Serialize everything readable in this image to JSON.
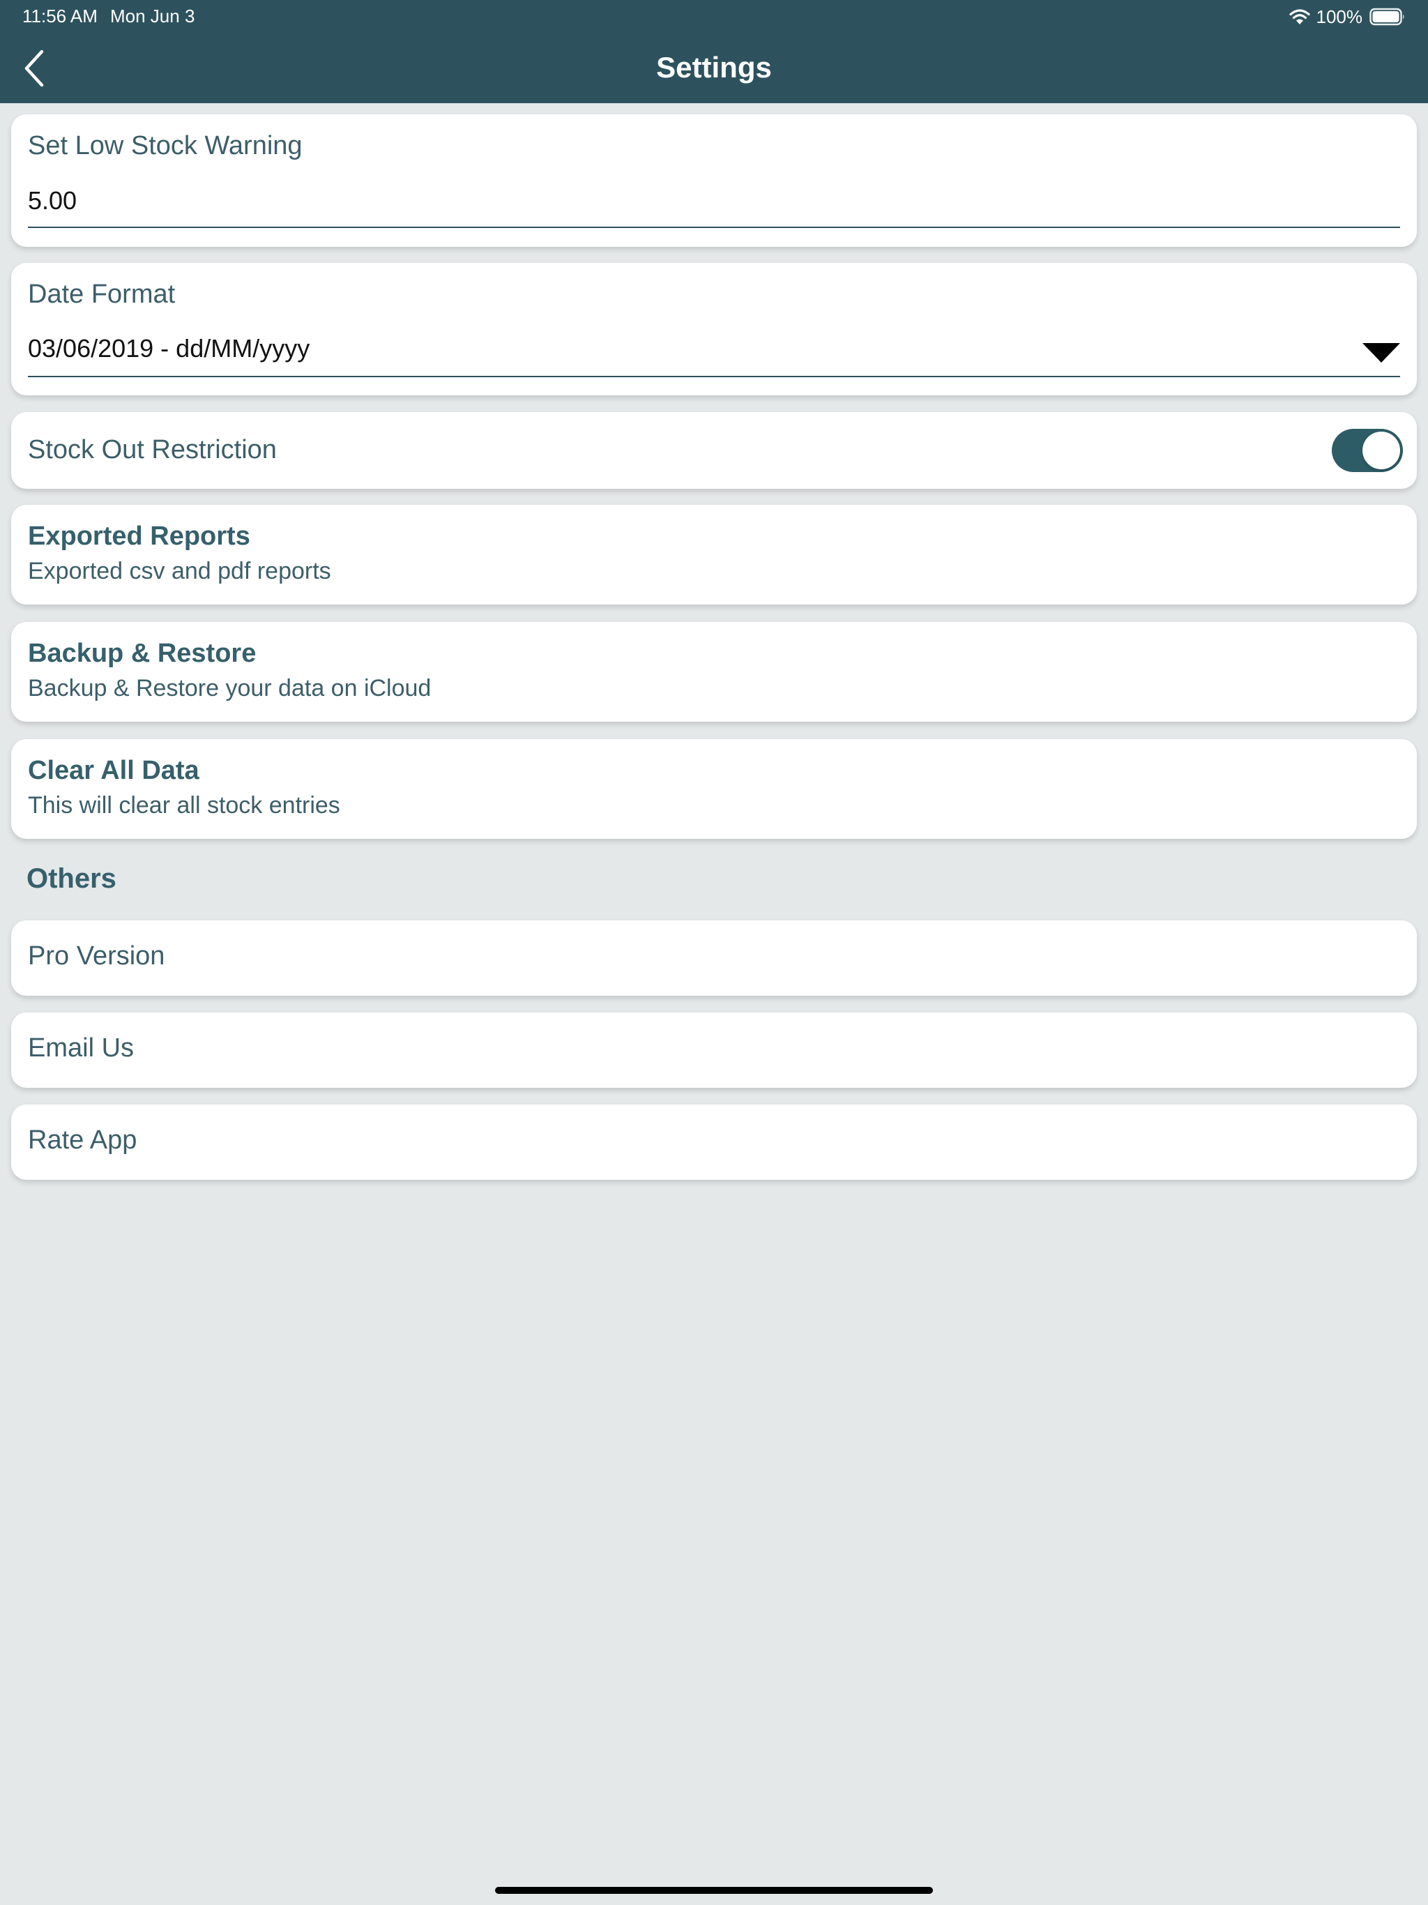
{
  "status_bar": {
    "time": "11:56 AM",
    "date": "Mon Jun 3",
    "battery": "100%"
  },
  "header": {
    "title": "Settings",
    "back_icon": "chevron-left-icon"
  },
  "low_stock": {
    "label": "Set Low Stock Warning",
    "value": "5.00"
  },
  "date_format": {
    "label": "Date Format",
    "value": "03/06/2019 - dd/MM/yyyy"
  },
  "stock_out": {
    "label": "Stock Out Restriction",
    "enabled": true
  },
  "exported_reports": {
    "title": "Exported Reports",
    "subtitle": "Exported csv and pdf reports"
  },
  "backup_restore": {
    "title": "Backup & Restore",
    "subtitle": "Backup & Restore your data on iCloud"
  },
  "clear_data": {
    "title": "Clear All Data",
    "subtitle": "This will clear all stock entries"
  },
  "others": {
    "header": "Others",
    "items": [
      {
        "label": "Pro Version"
      },
      {
        "label": "Email Us"
      },
      {
        "label": "Rate App"
      }
    ]
  },
  "colors": {
    "header_bg": "#2d525d",
    "page_bg": "#e4e8e9",
    "accent_text": "#36606b",
    "toggle_on": "#2d5c66"
  }
}
